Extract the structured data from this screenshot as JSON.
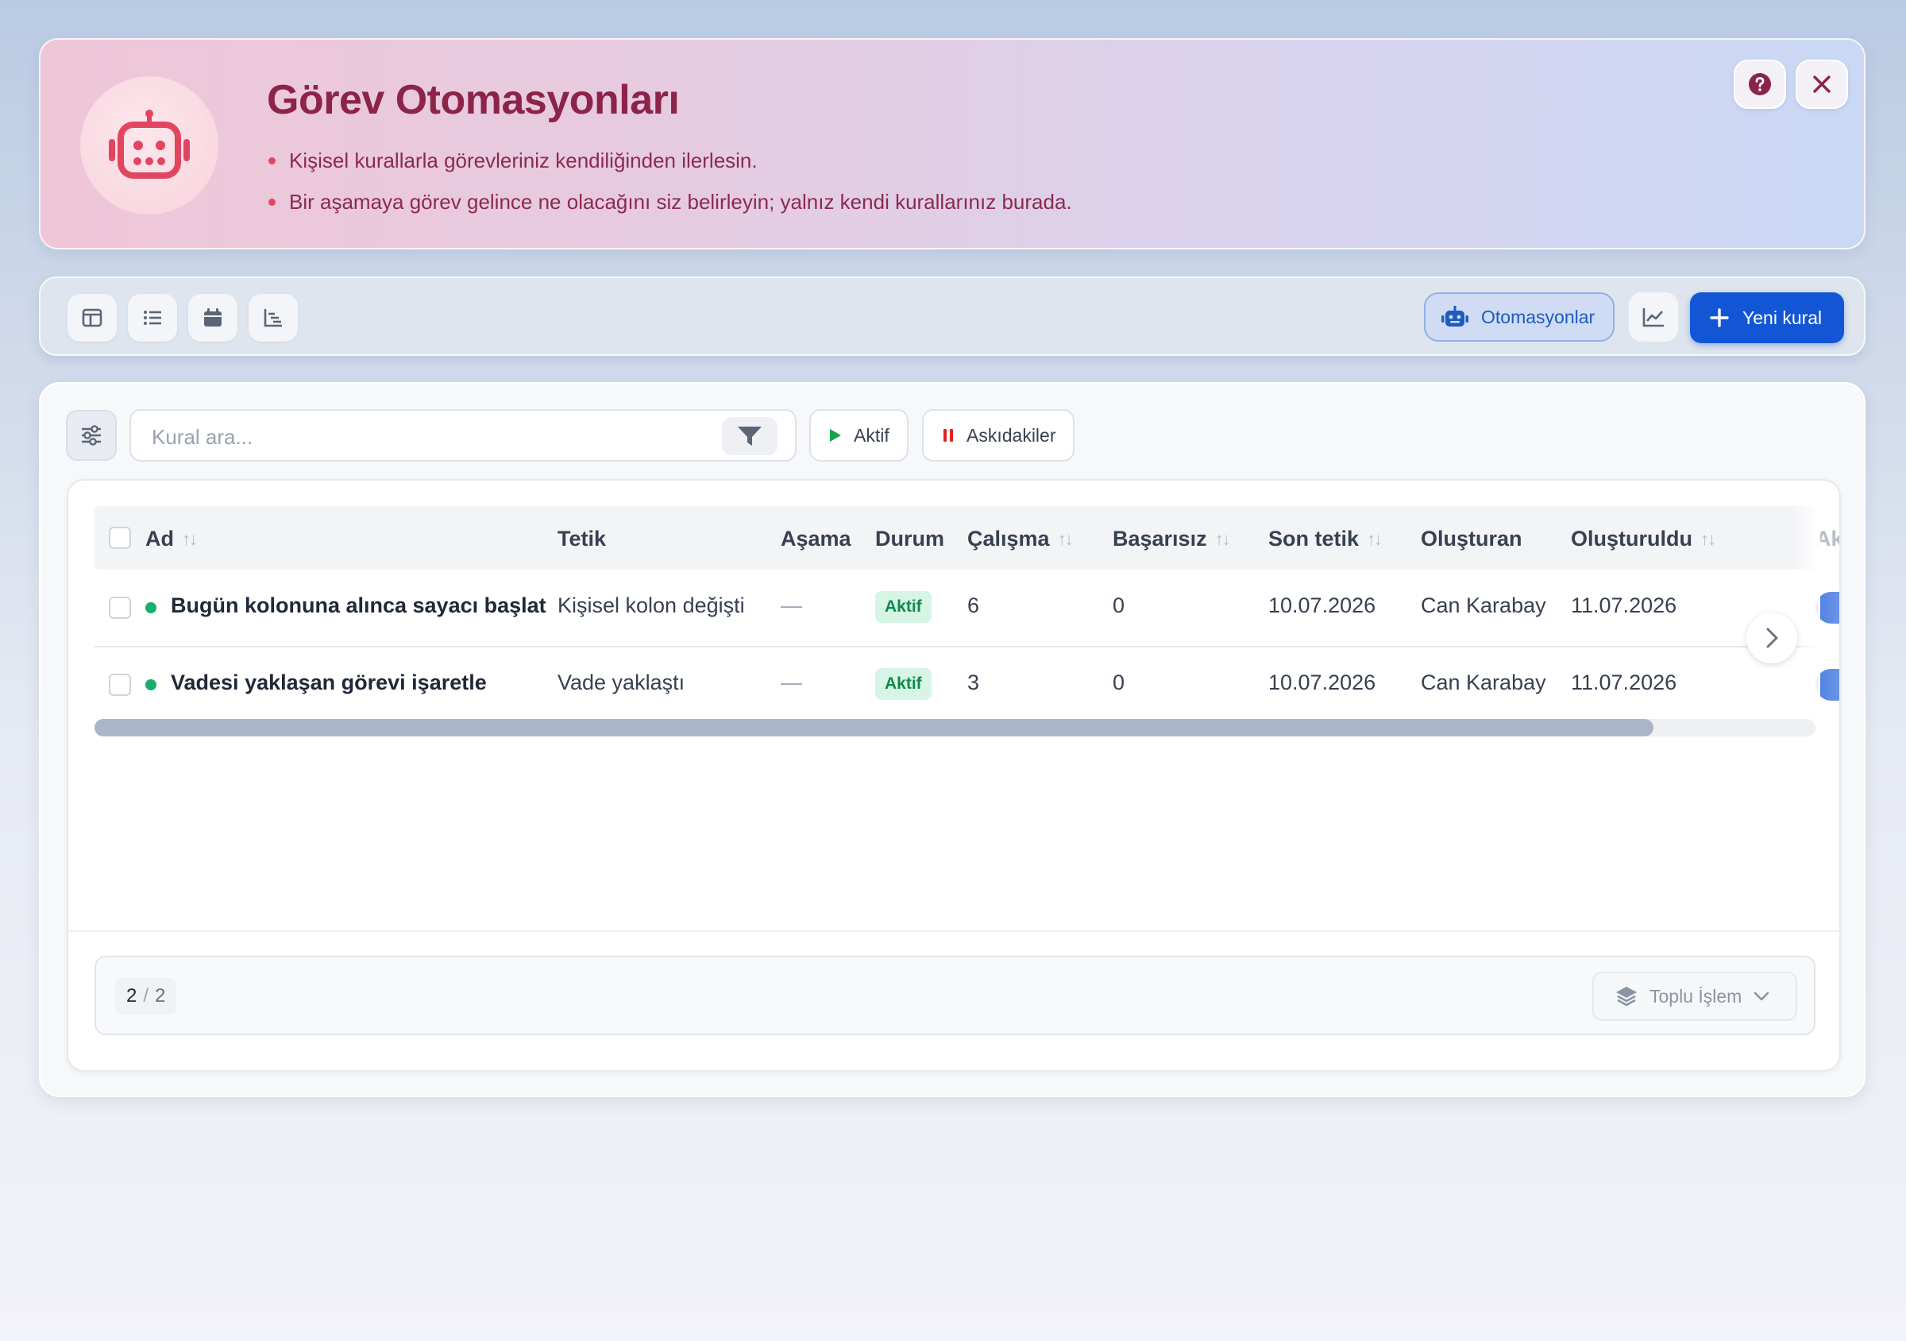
{
  "banner": {
    "title": "Görev Otomasyonları",
    "bullets": [
      "Kişisel kurallarla görevleriniz kendiliğinden ilerlesin.",
      "Bir aşamaya görev gelince ne olacağını siz belirleyin; yalnız kendi kurallarınız burada."
    ],
    "icon": "robot-icon",
    "accent_color": "#8b2448"
  },
  "toolbar": {
    "view_icons": [
      "board-view-icon",
      "list-view-icon",
      "calendar-view-icon",
      "timeline-view-icon"
    ],
    "automations_label": "Otomasyonlar",
    "new_rule_label": "Yeni kural",
    "primary_color": "#1256d6"
  },
  "filters": {
    "search_placeholder": "Kural ara...",
    "active_label": "Aktif",
    "paused_label": "Askıdakiler"
  },
  "table": {
    "columns": [
      "Ad",
      "Tetik",
      "Aşama",
      "Durum",
      "Çalışma",
      "Başarısız",
      "Son tetik",
      "Oluşturan",
      "Oluşturuldu",
      "Aktif"
    ],
    "rows": [
      {
        "name": "Bugün kolonuna alınca sayacı başlat",
        "trigger": "Kişisel kolon değişti",
        "stage": "—",
        "status": "Aktif",
        "runs": "6",
        "failed": "0",
        "last_trigger": "10.07.2026",
        "created_by": "Can Karabay",
        "created_at": "11.07.2026",
        "enabled": true
      },
      {
        "name": "Vadesi yaklaşan görevi işaretle",
        "trigger": "Vade yaklaştı",
        "stage": "—",
        "status": "Aktif",
        "runs": "3",
        "failed": "0",
        "last_trigger": "10.07.2026",
        "created_by": "Can Karabay",
        "created_at": "11.07.2026",
        "enabled": true
      }
    ],
    "horizontal_scroll_fraction": 0.906
  },
  "footer": {
    "shown": "2",
    "separator": "/",
    "total": "2",
    "bulk_action_label": "Toplu İşlem"
  }
}
